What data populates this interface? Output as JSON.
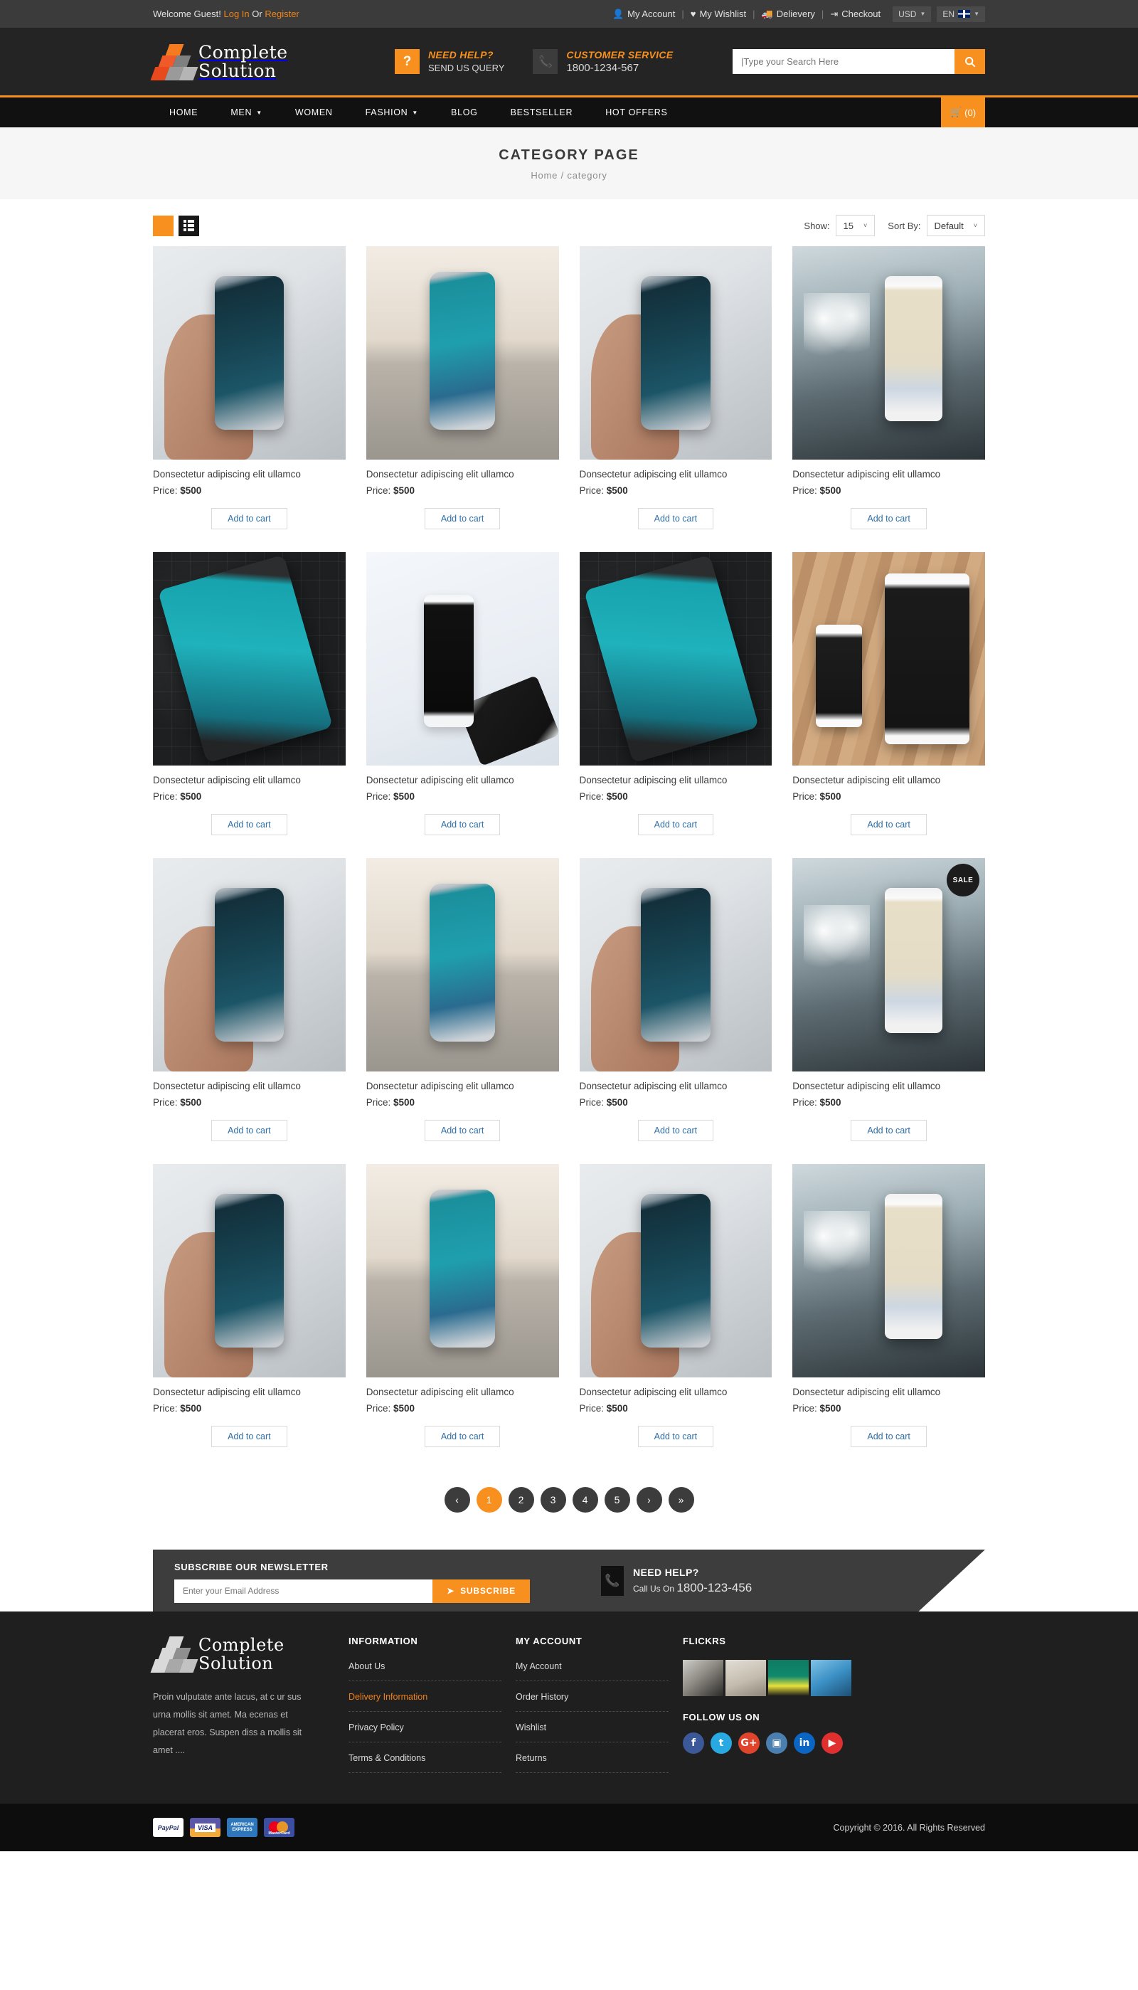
{
  "topbar": {
    "welcome_prefix": "Welcome Guest!",
    "login": "Log In",
    "or": "Or",
    "register": "Register",
    "links": [
      {
        "label": "My Account",
        "icon": "user-icon"
      },
      {
        "label": "My Wishlist",
        "icon": "heart-icon"
      },
      {
        "label": "Delievery",
        "icon": "truck-icon"
      },
      {
        "label": "Checkout",
        "icon": "logout-icon"
      }
    ],
    "divider": "|",
    "currency": "USD",
    "language": "EN"
  },
  "header": {
    "logo_line1": "Complete",
    "logo_line2": "Solution",
    "help": {
      "icon": "question-mark-icon",
      "title": "NEED HELP?",
      "subtitle": "SEND US QUERY"
    },
    "service": {
      "icon": "phone-icon",
      "title": "CUSTOMER SERVICE",
      "subtitle": "1800-1234-567"
    },
    "search": {
      "placeholder": "|Type your Search Here",
      "value": "",
      "icon": "search-icon"
    }
  },
  "nav": {
    "items": [
      {
        "label": "HOME",
        "has_dropdown": false
      },
      {
        "label": "MEN",
        "has_dropdown": true
      },
      {
        "label": "WOMEN",
        "has_dropdown": false
      },
      {
        "label": "FASHION",
        "has_dropdown": true
      },
      {
        "label": "BLOG",
        "has_dropdown": false
      },
      {
        "label": "BESTSELLER",
        "has_dropdown": false
      },
      {
        "label": "HOT OFFERS",
        "has_dropdown": false
      }
    ],
    "cart_count": "(0)"
  },
  "page": {
    "title": "CATEGORY PAGE",
    "breadcrumb": "Home / category"
  },
  "toolbar": {
    "grid_icon": "grid-view-icon",
    "list_icon": "list-view-icon",
    "show_label": "Show:",
    "show_value": "15",
    "sort_label": "Sort By:",
    "sort_value": "Default"
  },
  "products": [
    {
      "title": "Donsectetur adipiscing elit ullamco",
      "price_label": "Price:",
      "price": "$500",
      "cta": "Add to cart",
      "image": "ph-hand",
      "badge": null
    },
    {
      "title": "Donsectetur adipiscing elit ullamco",
      "price_label": "Price:",
      "price": "$500",
      "cta": "Add to cart",
      "image": "ph-stand",
      "badge": null
    },
    {
      "title": "Donsectetur adipiscing elit ullamco",
      "price_label": "Price:",
      "price": "$500",
      "cta": "Add to cart",
      "image": "ph-hand",
      "badge": null
    },
    {
      "title": "Donsectetur adipiscing elit ullamco",
      "price_label": "Price:",
      "price": "$500",
      "cta": "Add to cart",
      "image": "ph-car",
      "badge": null
    },
    {
      "title": "Donsectetur adipiscing elit ullamco",
      "price_label": "Price:",
      "price": "$500",
      "cta": "Add to cart",
      "image": "ph-map",
      "badge": null
    },
    {
      "title": "Donsectetur adipiscing elit ullamco",
      "price_label": "Price:",
      "price": "$500",
      "cta": "Add to cart",
      "image": "ph-white",
      "badge": null
    },
    {
      "title": "Donsectetur adipiscing elit ullamco",
      "price_label": "Price:",
      "price": "$500",
      "cta": "Add to cart",
      "image": "ph-map",
      "badge": null
    },
    {
      "title": "Donsectetur adipiscing elit ullamco",
      "price_label": "Price:",
      "price": "$500",
      "cta": "Add to cart",
      "image": "ph-wood",
      "badge": null
    },
    {
      "title": "Donsectetur adipiscing elit ullamco",
      "price_label": "Price:",
      "price": "$500",
      "cta": "Add to cart",
      "image": "ph-hand",
      "badge": null
    },
    {
      "title": "Donsectetur adipiscing elit ullamco",
      "price_label": "Price:",
      "price": "$500",
      "cta": "Add to cart",
      "image": "ph-stand",
      "badge": null
    },
    {
      "title": "Donsectetur adipiscing elit ullamco",
      "price_label": "Price:",
      "price": "$500",
      "cta": "Add to cart",
      "image": "ph-hand",
      "badge": null
    },
    {
      "title": "Donsectetur adipiscing elit ullamco",
      "price_label": "Price:",
      "price": "$500",
      "cta": "Add to cart",
      "image": "ph-car",
      "badge": "SALE"
    },
    {
      "title": "Donsectetur adipiscing elit ullamco",
      "price_label": "Price:",
      "price": "$500",
      "cta": "Add to cart",
      "image": "ph-hand",
      "badge": null
    },
    {
      "title": "Donsectetur adipiscing elit ullamco",
      "price_label": "Price:",
      "price": "$500",
      "cta": "Add to cart",
      "image": "ph-stand",
      "badge": null
    },
    {
      "title": "Donsectetur adipiscing elit ullamco",
      "price_label": "Price:",
      "price": "$500",
      "cta": "Add to cart",
      "image": "ph-hand",
      "badge": null
    },
    {
      "title": "Donsectetur adipiscing elit ullamco",
      "price_label": "Price:",
      "price": "$500",
      "cta": "Add to cart",
      "image": "ph-car",
      "badge": null
    }
  ],
  "pagination": [
    {
      "label": "‹",
      "name": "prev",
      "active": false
    },
    {
      "label": "1",
      "name": "page-1",
      "active": true
    },
    {
      "label": "2",
      "name": "page-2",
      "active": false
    },
    {
      "label": "3",
      "name": "page-3",
      "active": false
    },
    {
      "label": "4",
      "name": "page-4",
      "active": false
    },
    {
      "label": "5",
      "name": "page-5",
      "active": false
    },
    {
      "label": "›",
      "name": "next",
      "active": false
    },
    {
      "label": "»",
      "name": "last",
      "active": false
    }
  ],
  "newsletter": {
    "title": "SUBSCRIBE OUR NEWSLETTER",
    "placeholder": "Enter your Email Address",
    "value": "",
    "button": "SUBSCRIBE",
    "button_icon": "paper-plane-icon",
    "help_icon": "phone-icon",
    "help_title": "NEED HELP?",
    "help_prefix": "Call Us On",
    "help_phone": "1800-123-456"
  },
  "footer": {
    "logo_line1": "Complete",
    "logo_line2": "Solution",
    "description": "Proin vulputate ante lacus, at c ur sus urna mollis sit amet. Ma ecenas et placerat eros. Suspen diss a mollis sit amet ....",
    "information": {
      "heading": "INFORMATION",
      "items": [
        {
          "label": "About Us",
          "highlight": false
        },
        {
          "label": "Delivery Information",
          "highlight": true
        },
        {
          "label": "Privacy Policy",
          "highlight": false
        },
        {
          "label": "Terms & Conditions",
          "highlight": false
        }
      ]
    },
    "account": {
      "heading": "MY ACCOUNT",
      "items": [
        {
          "label": "My Account",
          "highlight": false
        },
        {
          "label": "Order History",
          "highlight": false
        },
        {
          "label": "Wishlist",
          "highlight": false
        },
        {
          "label": "Returns",
          "highlight": false
        }
      ]
    },
    "flickrs_heading": "FLICKRS",
    "follow_heading": "FOLLOW US ON",
    "socials": [
      {
        "name": "facebook",
        "glyph": "f",
        "color": "#3b5998"
      },
      {
        "name": "twitter",
        "glyph": "t",
        "color": "#29a9e1"
      },
      {
        "name": "google-plus",
        "glyph": "G+",
        "color": "#e0452c"
      },
      {
        "name": "instagram",
        "glyph": "▣",
        "color": "#4a7fb0"
      },
      {
        "name": "linkedin",
        "glyph": "in",
        "color": "#0a66c2"
      },
      {
        "name": "youtube",
        "glyph": "▶",
        "color": "#e02f2f"
      }
    ]
  },
  "bottom": {
    "payments": [
      {
        "name": "paypal",
        "label": "PayPal"
      },
      {
        "name": "visa",
        "label": "VISA"
      },
      {
        "name": "amex",
        "label": "AMERICAN EXPRESS"
      },
      {
        "name": "mastercard",
        "label": "MasterCard"
      }
    ],
    "copyright": "Copyright © 2016. All Rights Reserved"
  }
}
